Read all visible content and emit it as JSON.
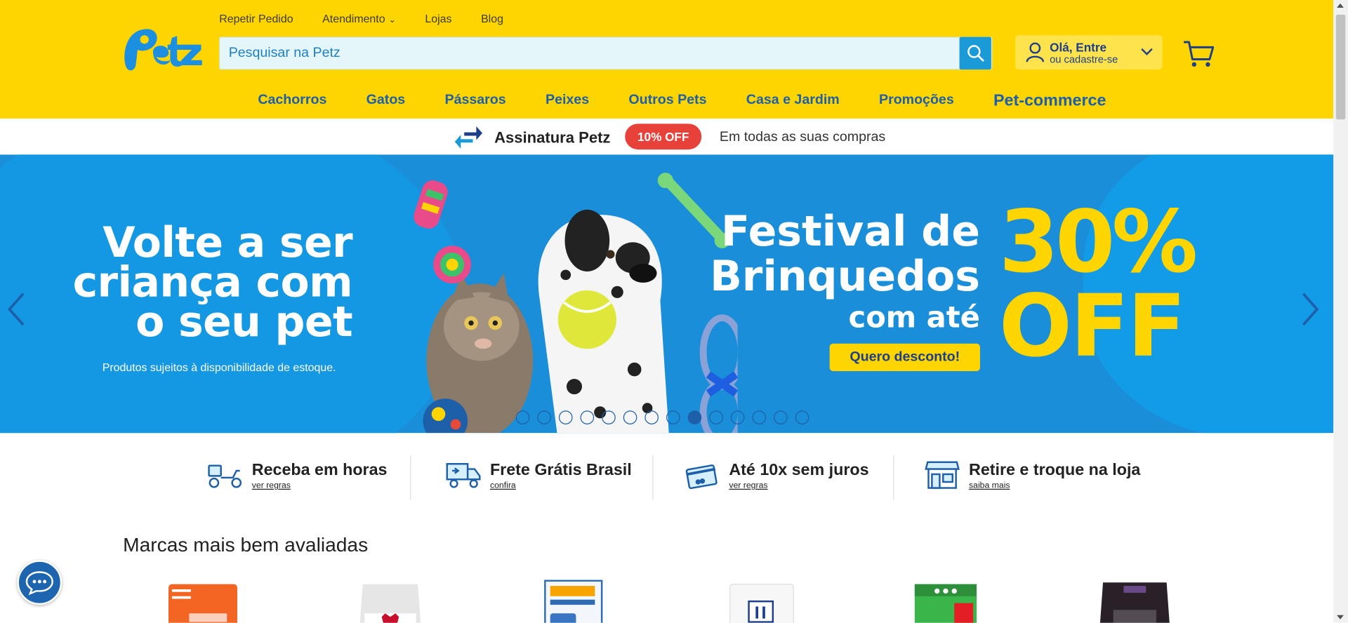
{
  "colors": {
    "header_bg": "#ffd500",
    "brand_blue": "#1d5fa8",
    "banner_bg": "#1a8ed8",
    "offer_red": "#e7413a",
    "accent_yellow": "#ffd500"
  },
  "top_links": {
    "repeat_order": "Repetir Pedido",
    "support": "Atendimento",
    "stores": "Lojas",
    "blog": "Blog"
  },
  "search": {
    "placeholder": "Pesquisar na Petz",
    "icon": "search-icon"
  },
  "account": {
    "greeting": "Olá, Entre",
    "subtitle": "ou cadastre-se",
    "icon": "user-icon"
  },
  "cart": {
    "icon": "cart-icon"
  },
  "nav": {
    "items": [
      "Cachorros",
      "Gatos",
      "Pássaros",
      "Peixes",
      "Outros Pets",
      "Casa e Jardim",
      "Promoções",
      "Pet-commerce"
    ]
  },
  "subscription": {
    "title": "Assinatura Petz",
    "badge": "10% OFF",
    "text": "Em todas as suas compras",
    "icon": "swap-arrows-icon"
  },
  "banner": {
    "headline": [
      "Volte a ser",
      "criança com",
      "o seu pet"
    ],
    "disclaimer": "Produtos sujeitos à disponibilidade de estoque.",
    "festival": [
      "Festival de",
      "Brinquedos"
    ],
    "with_up_to": "com até",
    "cta": "Quero desconto!",
    "percent": "30%",
    "off": "OFF",
    "slides_total": 14,
    "active_slide": 8
  },
  "benefits": [
    {
      "title": "Receba em horas",
      "link": "ver regras",
      "icon": "scooter-delivery-icon"
    },
    {
      "title": "Frete Grátis Brasil",
      "link": "confira",
      "icon": "truck-icon"
    },
    {
      "title": "Até 10x sem juros",
      "link": "ver regras",
      "icon": "credit-card-icon"
    },
    {
      "title": "Retire e troque na loja",
      "link": "saiba mais",
      "icon": "store-icon"
    }
  ],
  "brands": {
    "title": "Marcas mais bem avaliadas"
  },
  "chat": {
    "icon": "chat-bubble-icon"
  }
}
